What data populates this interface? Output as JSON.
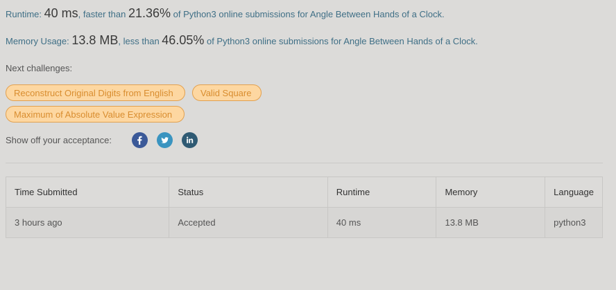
{
  "runtime": {
    "label": "Runtime: ",
    "value": "40 ms",
    "middle": ", faster than ",
    "percent": "21.36%",
    "suffix": " of Python3 online submissions for Angle Between Hands of a Clock."
  },
  "memory": {
    "label": "Memory Usage: ",
    "value": "13.8 MB",
    "middle": ", less than ",
    "percent": "46.05%",
    "suffix": " of Python3 online submissions for Angle Between Hands of a Clock."
  },
  "next_challenges": {
    "label": "Next challenges:",
    "items": [
      "Reconstruct Original Digits from English",
      "Valid Square",
      "Maximum of Absolute Value Expression"
    ]
  },
  "share": {
    "label": "Show off your acceptance:",
    "icons": [
      "facebook-icon",
      "twitter-icon",
      "linkedin-icon"
    ]
  },
  "table": {
    "headers": [
      "Time Submitted",
      "Status",
      "Runtime",
      "Memory",
      "Language"
    ],
    "rows": [
      [
        "3 hours ago",
        "Accepted",
        "40 ms",
        "13.8 MB",
        "python3"
      ]
    ]
  },
  "colors": {
    "background": "#dcdbd9",
    "link": "#3f6f86",
    "chip_fill": "#fdd7a1",
    "chip_text": "#d98d2f",
    "accepted": "#3e8a6a"
  }
}
